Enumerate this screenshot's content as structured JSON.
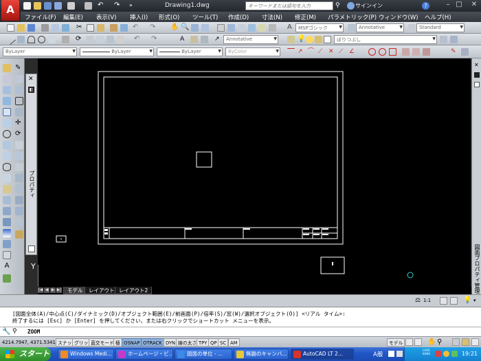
{
  "window": {
    "title": "Drawing1.dwg",
    "search_placeholder": "キーワードまたは語句を入力",
    "signin": "サインイン",
    "app_logo": "A"
  },
  "menu": {
    "items": [
      "ファイル(F)",
      "編集(E)",
      "表示(V)",
      "挿入(I)",
      "形式(O)",
      "ツール(T)",
      "作成(D)",
      "寸法(N)",
      "修正(M)",
      "パラメトリック(P)",
      "ウィンドウ(W)",
      "ヘルプ(H)"
    ]
  },
  "toolbar": {
    "text_style": "MSPゴシック",
    "dim_style": "Annotative",
    "table_style": "Standard",
    "mleader_style": "Annotative",
    "layer": "ぼりつぶし",
    "layer_bylayer": "ByLayer",
    "color": "ByLayer",
    "linetype": "ByLayer",
    "lineweight": "ByLayer",
    "plotstyle": "ByColor"
  },
  "palettes": {
    "properties_label": "プロパティ",
    "sheet_set_label": "図面プロパティ管理"
  },
  "canvas": {
    "ucs_label": "Y"
  },
  "layout_tabs": {
    "tabs": [
      "モデル",
      "レイアウト1",
      "レイアウト2"
    ],
    "active": 0
  },
  "annotation": {
    "scale": "1:1"
  },
  "command": {
    "history_1": "[図面全体(A)/中心点(C)/ダイナミック(D)/オブジェクト範囲(E)/前画面(P)/倍率(S)/窓(W)/選択オブジェクト(O)] <リアル タイム>:",
    "history_2": "終了するには [Esc] か [Enter] を押してください、または右クリックでショートカット メニューを表示。",
    "current": "ZOOM"
  },
  "status": {
    "coords": "4214.7947, 4371.5341, 0.0000",
    "buttons": [
      {
        "label": "スナップ",
        "on": false
      },
      {
        "label": "グリッド",
        "on": false
      },
      {
        "label": "直交モード",
        "on": false
      },
      {
        "label": "極",
        "on": false
      },
      {
        "label": "OSNAP",
        "on": true
      },
      {
        "label": "OTRACK",
        "on": true
      },
      {
        "label": "DYN",
        "on": false
      },
      {
        "label": "線の太さ",
        "on": false
      },
      {
        "label": "TPY",
        "on": false
      },
      {
        "label": "QP",
        "on": false
      },
      {
        "label": "SC",
        "on": false
      },
      {
        "label": "AM",
        "on": false
      }
    ],
    "model_label": "モデル"
  },
  "taskbar": {
    "start": "スタート",
    "items": [
      {
        "label": "Windows Medi...",
        "active": false,
        "color": "#f08a24"
      },
      {
        "label": "ホームページ・ビ...",
        "active": false,
        "color": "#c43ac8"
      },
      {
        "label": "図面の単位 - ...",
        "active": false,
        "color": "#3b8ae6"
      },
      {
        "label": "無題のキャンバ...",
        "active": false,
        "color": "#e8c838"
      },
      {
        "label": "AutoCAD LT 2...",
        "active": true,
        "color": "#d8332a"
      }
    ],
    "ime": "A般",
    "caps": "CAPS KANA",
    "clock": "19:21"
  },
  "colors": {
    "canvas_bg": "#000000",
    "drawing_lines": "#ffffff",
    "titlebar": "#2b2f35",
    "taskbar": "#245edb",
    "start_green": "#3c9a34",
    "cursor_cyan": "#2fd0c8"
  }
}
